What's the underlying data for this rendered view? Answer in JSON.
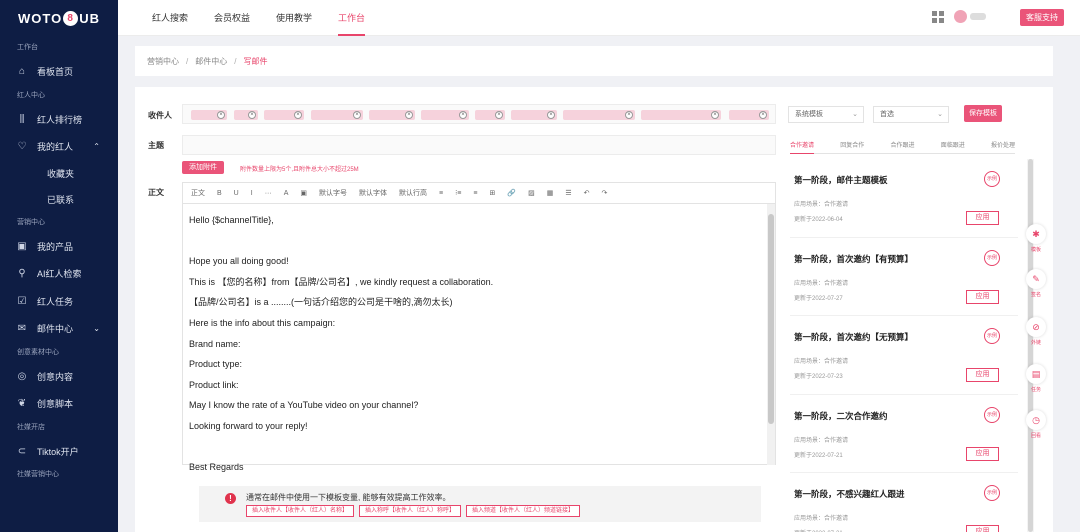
{
  "brand": {
    "logo_left": "WOTO",
    "logo_circle": "8",
    "logo_right": "UB"
  },
  "sidebar": {
    "s0": "工作台",
    "dashboard": "看板首页",
    "s1": "红人中心",
    "rank": "红人排行榜",
    "my_influencers": "我的红人",
    "favorites": "收藏夹",
    "contacted": "已联系",
    "s2": "营销中心",
    "products": "我的产品",
    "ai_search": "AI红人检索",
    "tasks": "红人任务",
    "mail_center": "邮件中心",
    "s3": "创意素材中心",
    "creative": "创意内容",
    "script": "创意脚本",
    "s4": "社媒开店",
    "tiktok": "Tiktok开户",
    "s5": "社媒营销中心"
  },
  "topnav": {
    "items": [
      "红人搜索",
      "会员权益",
      "使用教学",
      "工作台"
    ],
    "active_index": 3,
    "service_button": "客服支持"
  },
  "breadcrumb": {
    "items": [
      "营销中心",
      "邮件中心"
    ],
    "current": "写邮件",
    "sep": "/"
  },
  "form": {
    "recipient_label": "收件人",
    "subject_label": "主题",
    "body_label": "正文",
    "attach_button": "添加附件",
    "attach_hint": "附件数量上限为5个,且附件总大小不超过25M"
  },
  "toolbar": {
    "items": [
      "正文",
      "B",
      "U",
      "I",
      "···",
      "A",
      "▣",
      "默认字号",
      "默认字体",
      "默认行高",
      "≡",
      "⁝≡",
      "≡",
      "⊞",
      "🔗",
      "▨",
      "▦",
      "☰",
      "↶",
      "↷"
    ]
  },
  "body_lines": [
    "Hello {$channelTitle},",
    "",
    "Hope you all doing good!",
    "This is 【您的名称】from【品牌/公司名】, we kindly request a collaboration.",
    "【品牌/公司名】is a ........(一句话介绍您的公司是干啥的,滴勿太长)",
    "Here is the info about this campaign:",
    "Brand name:",
    "Product type:",
    "Product link:",
    "May I know the rate of a YouTube video on your channel?",
    "Looking forward to your reply!",
    "",
    "Best Regards"
  ],
  "tip": {
    "icon": "!",
    "text": "通常在邮件中使用一下模板变量, 能够有效提高工作效率。",
    "buttons": [
      "插入收件人【收件人（红人）名称】",
      "插入称呼【收件人（红人）称呼】",
      "插入频道【收件人（红人）频道链接】"
    ]
  },
  "right": {
    "select1": "系统模板",
    "select2": "首选",
    "save_button": "保存模板",
    "tabs": [
      "合作邀请",
      "回复合作",
      "合作跟进",
      "面临跟进",
      "报价处理"
    ],
    "active_tab": 0,
    "templates": [
      {
        "title": "第一阶段，邮件主题模板",
        "category": "应用场景：合作邀请",
        "date": "更新于2022-06-04",
        "badge": "示例",
        "apply": "应用"
      },
      {
        "title": "第一阶段，首次邀约【有预算】",
        "category": "应用场景：合作邀请",
        "date": "更新于2022-07-27",
        "badge": "示例",
        "apply": "应用"
      },
      {
        "title": "第一阶段，首次邀约【无预算】",
        "category": "应用场景：合作邀请",
        "date": "更新于2022-07-23",
        "badge": "示例",
        "apply": "应用"
      },
      {
        "title": "第一阶段，二次合作邀约",
        "category": "应用场景：合作邀请",
        "date": "更新于2022-07-21",
        "badge": "示例",
        "apply": "应用"
      },
      {
        "title": "第一阶段，不感兴趣红人跟进",
        "category": "应用场景：合作邀请",
        "date": "更新于2022-07-21",
        "badge": "示例",
        "apply": "应用"
      }
    ]
  },
  "floating": [
    "模板",
    "签名",
    "外链",
    "任务",
    "回看"
  ],
  "colors": {
    "accent": "#e8456b",
    "sidebar_bg": "#0e1d44"
  }
}
